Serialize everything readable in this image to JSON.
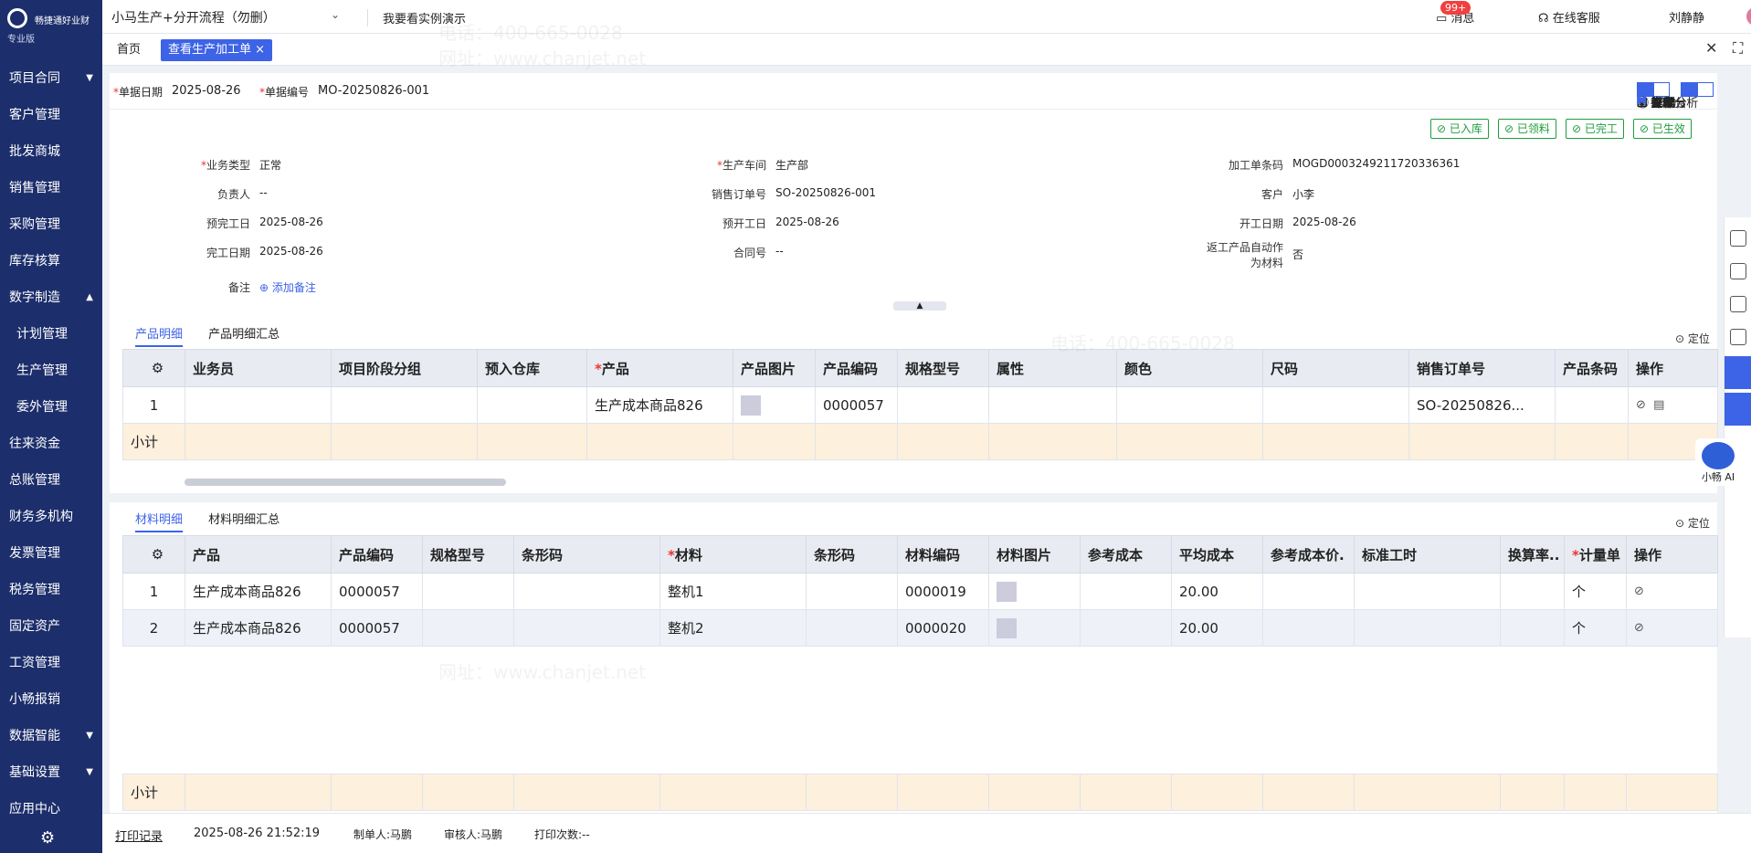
{
  "app": {
    "name": "畅捷通好业财",
    "edition": "专业版"
  },
  "topbar": {
    "project": "小马生产+分开流程（勿删）",
    "demo": "我要看实例演示",
    "messages": "消息",
    "badge": "99+",
    "service": "在线客服",
    "user": "刘静静"
  },
  "sidebar": {
    "items": [
      "项目合同",
      "客户管理",
      "批发商城",
      "销售管理",
      "采购管理",
      "库存核算",
      "数字制造",
      "计划管理",
      "生产管理",
      "委外管理",
      "往来资金",
      "总账管理",
      "财务多机构",
      "发票管理",
      "税务管理",
      "固定资产",
      "工资管理",
      "小畅报销",
      "数据智能",
      "基础设置",
      "应用中心"
    ]
  },
  "tabs": {
    "home": "首页",
    "current": "查看生产加工单 ×"
  },
  "header": {
    "date_label": "单据日期",
    "date": "2025-08-26",
    "no_label": "单据编号",
    "no": "MO-20250826-001"
  },
  "toolbar": {
    "help": "帮助",
    "analysis": "齐套分析",
    "add": "新增",
    "generate": "生成",
    "copy": "复制",
    "print": "打印",
    "ops": "操作",
    "workbench": "工作台"
  },
  "status": [
    "已入库",
    "已领料",
    "已完工",
    "已生效"
  ],
  "fields": {
    "biz_type_l": "业务类型",
    "biz_type": "正常",
    "owner_l": "负责人",
    "owner": "--",
    "plan_done_l": "预完工日",
    "plan_done": "2025-08-26",
    "done_l": "完工日期",
    "done": "2025-08-26",
    "note_l": "备注",
    "note": "添加备注",
    "workshop_l": "生产车间",
    "workshop": "生产部",
    "so_l": "销售订单号",
    "so": "SO-20250826-001",
    "plan_start_l": "预开工日",
    "plan_start": "2025-08-26",
    "contract_l": "合同号",
    "contract": "--",
    "barcode_l": "加工单条码",
    "barcode": "MOGD0003249211720336361",
    "customer_l": "客户",
    "customer": "小李",
    "start_l": "开工日期",
    "start": "2025-08-26",
    "rework_l1": "返工产品自动作",
    "rework_l2": "为材料",
    "rework": "否"
  },
  "product_section": {
    "tab1": "产品明细",
    "tab2": "产品明细汇总",
    "locate": "定位",
    "headers": [
      "业务员",
      "项目阶段分组",
      "预入仓库",
      "产品",
      "产品图片",
      "产品编码",
      "规格型号",
      "属性",
      "颜色",
      "尺码",
      "销售订单号",
      "产品条码",
      "操作"
    ],
    "row": {
      "no": "1",
      "product": "生产成本商品826",
      "code": "0000057",
      "so": "SO-20250826..."
    },
    "subtotal": "小计"
  },
  "material_section": {
    "tab1": "材料明细",
    "tab2": "材料明细汇总",
    "locate": "定位",
    "headers": [
      "产品",
      "产品编码",
      "规格型号",
      "条形码",
      "材料",
      "条形码",
      "材料编码",
      "材料图片",
      "参考成本",
      "平均成本",
      "参考成本价.",
      "标准工时",
      "换算率..",
      "计量单",
      "操作"
    ],
    "rows": [
      {
        "no": "1",
        "product": "生产成本商品826",
        "code": "0000057",
        "material": "整机1",
        "mcode": "0000019",
        "avg": "20.00",
        "unit": "个"
      },
      {
        "no": "2",
        "product": "生产成本商品826",
        "code": "0000057",
        "material": "整机2",
        "mcode": "0000020",
        "avg": "20.00",
        "unit": "个"
      }
    ],
    "subtotal": "小计"
  },
  "footer": {
    "print": "打印记录",
    "time": "2025-08-26 21:52:19",
    "maker": "制单人:马鹏",
    "reviewer": "审核人:马鹏",
    "count": "打印次数:--"
  },
  "bot": {
    "label": "小畅 AI"
  },
  "watermark": {
    "phone": "电话：400-665-0028",
    "site": "网址：www.chanjet.net"
  }
}
